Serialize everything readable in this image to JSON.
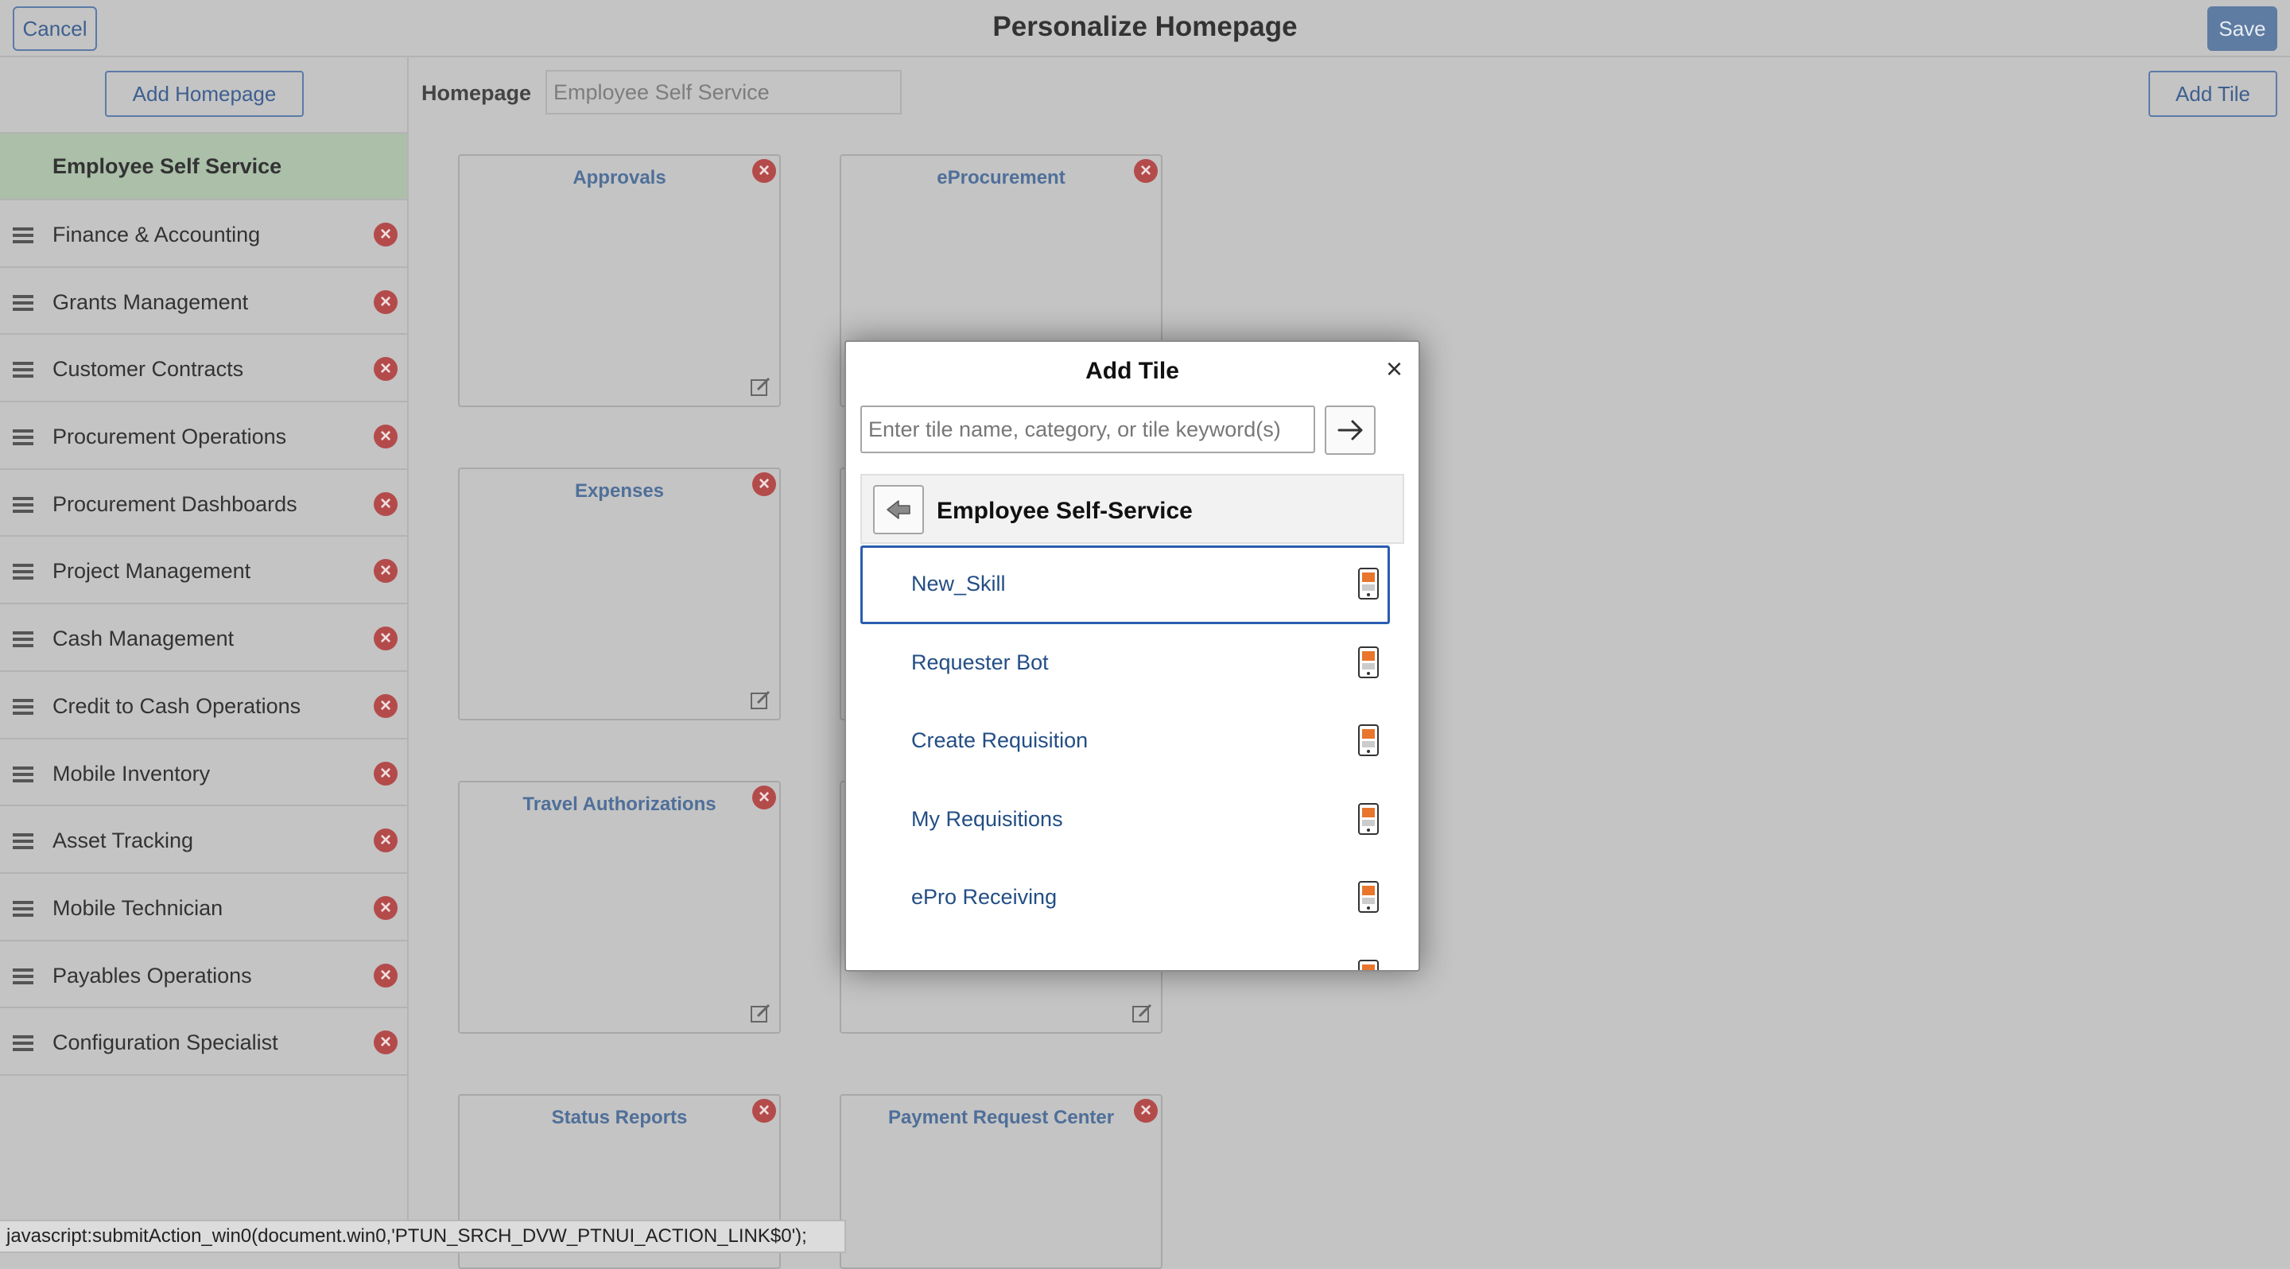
{
  "header": {
    "cancel_label": "Cancel",
    "title": "Personalize Homepage",
    "save_label": "Save"
  },
  "sidebar": {
    "add_homepage_label": "Add Homepage",
    "active_item": "Employee Self Service",
    "items": [
      {
        "label": "Finance & Accounting"
      },
      {
        "label": "Grants Management"
      },
      {
        "label": "Customer Contracts"
      },
      {
        "label": "Procurement Operations"
      },
      {
        "label": "Procurement Dashboards"
      },
      {
        "label": "Project Management"
      },
      {
        "label": "Cash Management"
      },
      {
        "label": "Credit to Cash Operations"
      },
      {
        "label": "Mobile Inventory"
      },
      {
        "label": "Asset Tracking"
      },
      {
        "label": "Mobile Technician"
      },
      {
        "label": "Payables Operations"
      },
      {
        "label": "Configuration Specialist"
      }
    ]
  },
  "main": {
    "homepage_label": "Homepage",
    "homepage_value": "Employee Self Service",
    "add_tile_label": "Add Tile",
    "tiles": [
      {
        "title": "Approvals"
      },
      {
        "title": "eProcurement"
      },
      {
        "title": "Expenses"
      },
      {
        "title": ""
      },
      {
        "title": "Travel Authorizations"
      },
      {
        "title": ""
      },
      {
        "title": "Status Reports"
      },
      {
        "title": "Payment Request Center"
      }
    ]
  },
  "modal": {
    "title": "Add Tile",
    "close_glyph": "×",
    "search_placeholder": "Enter tile name, category, or tile keyword(s)",
    "category_title": "Employee Self-Service",
    "items": [
      {
        "label": "New_Skill"
      },
      {
        "label": "Requester Bot"
      },
      {
        "label": "Create Requisition"
      },
      {
        "label": "My Requisitions"
      },
      {
        "label": "ePro Receiving"
      },
      {
        "label": ""
      }
    ]
  },
  "statusbar": {
    "text": "javascript:submitAction_win0(document.win0,'PTUN_SRCH_DVW_PTNUI_ACTION_LINK$0');"
  },
  "colors": {
    "accent": "#5b7ba8",
    "remove_icon": "#b44b4b",
    "active_item_bg": "#abbfa9",
    "selected_border": "#2a5db0",
    "mobile_icon_orange": "#e8762d"
  }
}
